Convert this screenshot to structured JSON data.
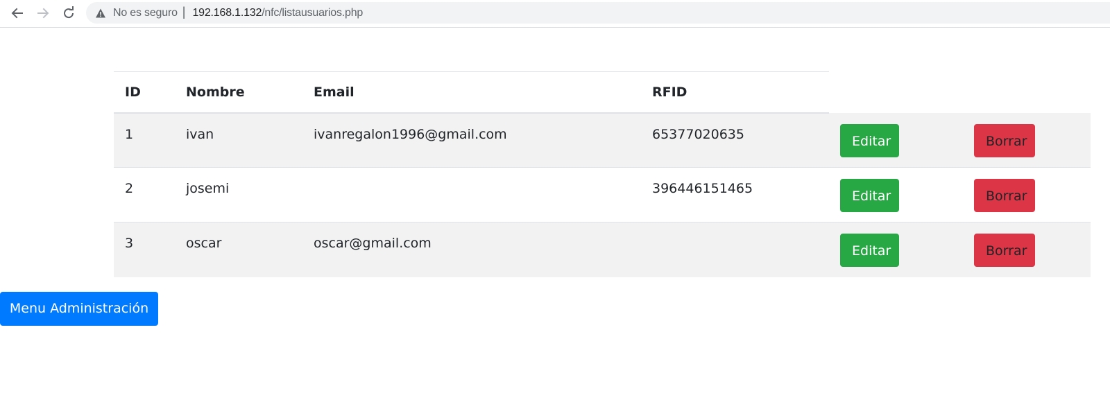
{
  "browser": {
    "security_label": "No es seguro",
    "separator": "|",
    "url_host": "192.168.1.132",
    "url_path": "/nfc/listausuarios.php",
    "icons": {
      "back": "arrow-left-icon",
      "forward": "arrow-right-icon",
      "reload": "reload-icon",
      "warning": "warning-triangle-icon"
    }
  },
  "table": {
    "headers": {
      "id": "ID",
      "name": "Nombre",
      "email": "Email",
      "rfid": "RFID"
    },
    "rows": [
      {
        "id": "1",
        "name": "ivan",
        "email": "ivanregalon1996@gmail.com",
        "rfid": "65377020635",
        "edit_label": "Editar",
        "delete_label": "Borrar"
      },
      {
        "id": "2",
        "name": "josemi",
        "email": "",
        "rfid": "396446151465",
        "edit_label": "Editar",
        "delete_label": "Borrar"
      },
      {
        "id": "3",
        "name": "oscar",
        "email": "oscar@gmail.com",
        "rfid": "",
        "edit_label": "Editar",
        "delete_label": "Borrar"
      }
    ]
  },
  "admin_menu_button": "Menu Administración",
  "colors": {
    "success": "#28a745",
    "danger": "#dc3545",
    "primary": "#007bff",
    "stripe": "#f2f2f2"
  }
}
